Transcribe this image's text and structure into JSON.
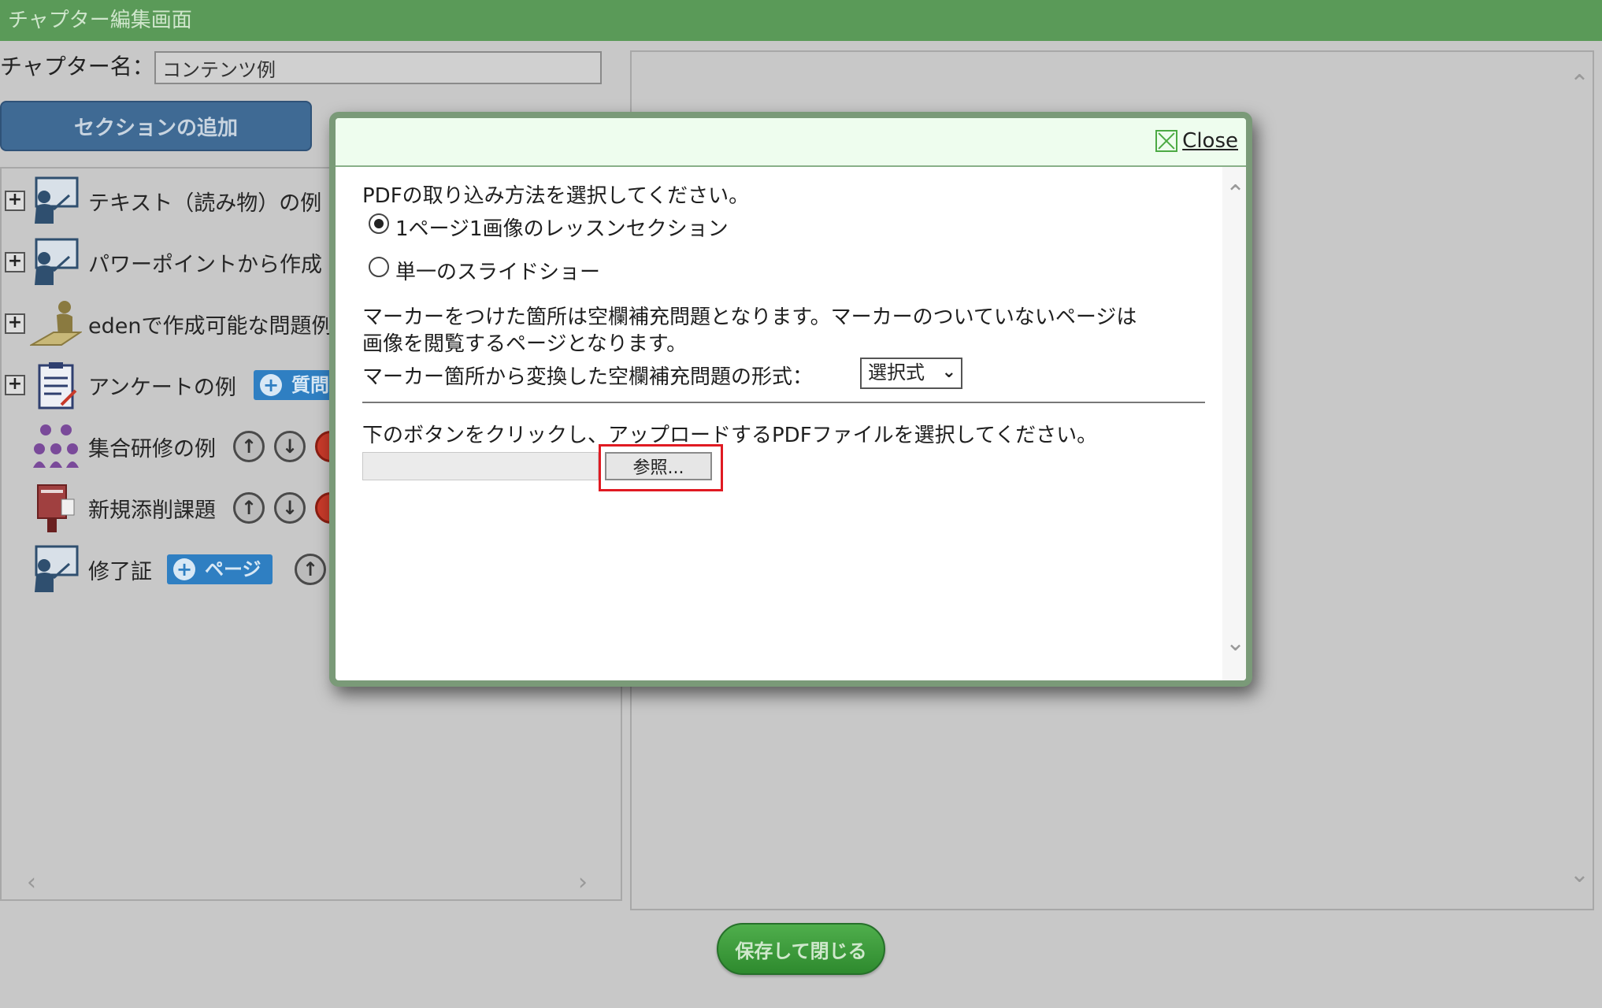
{
  "header": {
    "title": "チャプター編集画面"
  },
  "chapter": {
    "label": "チャプター名：",
    "name_value": "コンテンツ例"
  },
  "add_section_label": "セクションの追加",
  "tree": {
    "items": [
      {
        "label": "テキスト（読み物）の例",
        "icon": "teacher-board-icon"
      },
      {
        "label": "パワーポイントから作成",
        "icon": "teacher-board-icon"
      },
      {
        "label": "edenで作成可能な問題例",
        "icon": "student-writing-icon"
      },
      {
        "label": "アンケートの例",
        "icon": "clipboard-icon",
        "tag": "質問"
      },
      {
        "label": "集合研修の例",
        "icon": "group-training-icon"
      },
      {
        "label": "新規添削課題",
        "icon": "post-box-icon"
      },
      {
        "label": "修了証",
        "icon": "teacher-board-icon",
        "tag": "ページ"
      }
    ]
  },
  "save_button_label": "保存して閉じる",
  "modal": {
    "close_label": "Close",
    "prompt": "PDFの取り込み方法を選択してください。",
    "options": [
      {
        "label": "1ページ1画像のレッスンセクション",
        "checked": true
      },
      {
        "label": "単一のスライドショー",
        "checked": false
      }
    ],
    "note_line1": "マーカーをつけた箇所は空欄補充問題となります。マーカーのついていないページは",
    "note_line2": "画像を閲覧するページとなります。",
    "format_label": "マーカー箇所から変換した空欄補充問題の形式：",
    "format_value": "選択式",
    "upload_instruction": "下のボタンをクリックし、アップロードするPDFファイルを選択してください。",
    "browse_label": "参照..."
  },
  "colors": {
    "header_bg": "#5a9a58",
    "add_button_bg": "#3f6a94",
    "save_button_bg": "#3c9c3a",
    "highlight": "#e01a22",
    "tag_bg": "#2f7fc2"
  }
}
